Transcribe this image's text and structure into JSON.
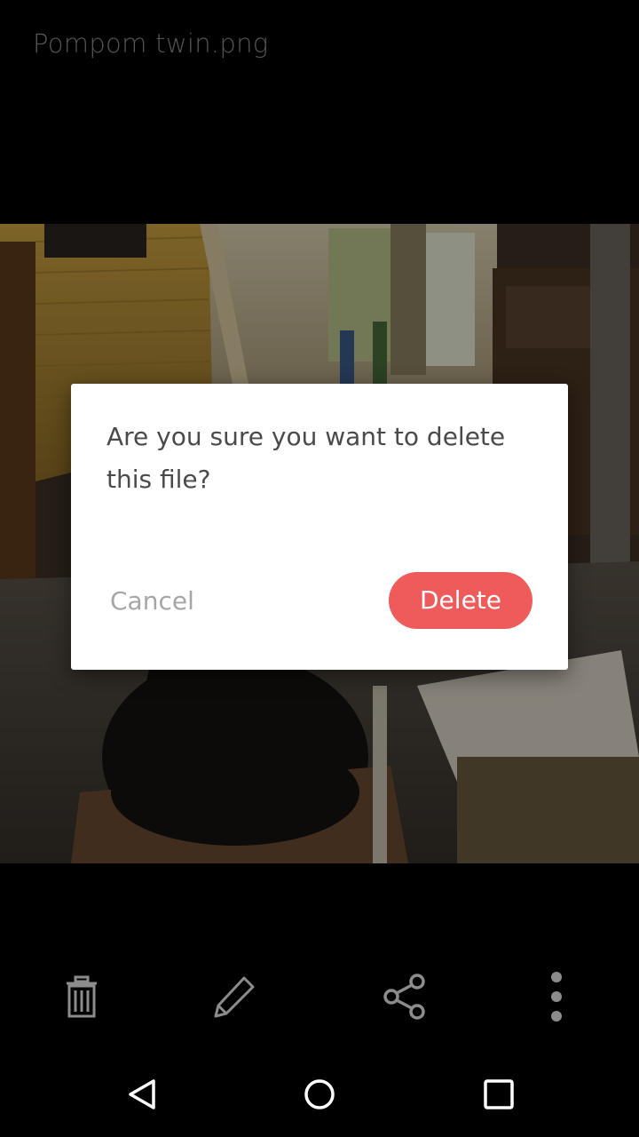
{
  "header": {
    "file_name": "Pompom twin.png"
  },
  "dialog": {
    "message": "Are you sure you want to delete this file?",
    "cancel_label": "Cancel",
    "delete_label": "Delete",
    "delete_color": "#ef5a5a"
  },
  "toolbar": {
    "items": [
      {
        "icon": "trash-icon"
      },
      {
        "icon": "pencil-icon"
      },
      {
        "icon": "share-icon"
      },
      {
        "icon": "more-vertical-icon"
      }
    ]
  },
  "navbar": {
    "items": [
      {
        "icon": "back-icon"
      },
      {
        "icon": "home-icon"
      },
      {
        "icon": "recents-icon"
      }
    ]
  }
}
